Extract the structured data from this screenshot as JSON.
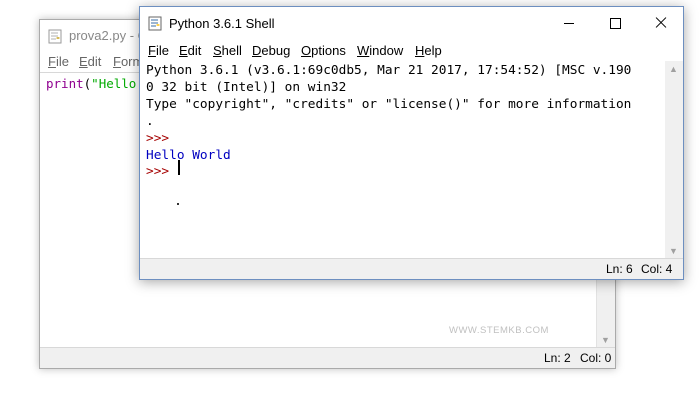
{
  "editor_window": {
    "title": "prova2.py - C",
    "menu": [
      {
        "accel": "F",
        "rest": "ile"
      },
      {
        "accel": "E",
        "rest": "dit"
      },
      {
        "accel": "F",
        "rest": "orm"
      }
    ],
    "code": {
      "keyword": "print",
      "paren": "(",
      "string": "\"Hello"
    },
    "status": {
      "ln": "Ln: 2",
      "col": "Col: 0"
    },
    "watermark": "WWW.STEMKB.COM"
  },
  "shell_window": {
    "title": "Python 3.6.1 Shell",
    "menu": [
      {
        "accel": "F",
        "rest": "ile"
      },
      {
        "accel": "E",
        "rest": "dit"
      },
      {
        "accel": "S",
        "rest": "hell"
      },
      {
        "accel": "D",
        "rest": "ebug"
      },
      {
        "accel": "O",
        "rest": "ptions"
      },
      {
        "accel": "W",
        "rest": "indow"
      },
      {
        "accel": "H",
        "rest": "elp"
      }
    ],
    "lines": {
      "banner1": "Python 3.6.1 (v3.6.1:69c0db5, Mar 21 2017, 17:54:52) [MSC v.190",
      "banner2": "0 32 bit (Intel)] on win32",
      "banner3": "Type \"copyright\", \"credits\" or \"license()\" for more information",
      "banner4": ".",
      "prompt1": ">>> ",
      "output": "Hello World",
      "prompt2": ">>> "
    },
    "status": {
      "ln": "Ln: 6",
      "col": "Col: 4"
    }
  },
  "icons": {
    "app": "python-idle-icon",
    "minimize": "minimize-icon",
    "maximize": "maximize-icon",
    "close": "close-icon"
  }
}
